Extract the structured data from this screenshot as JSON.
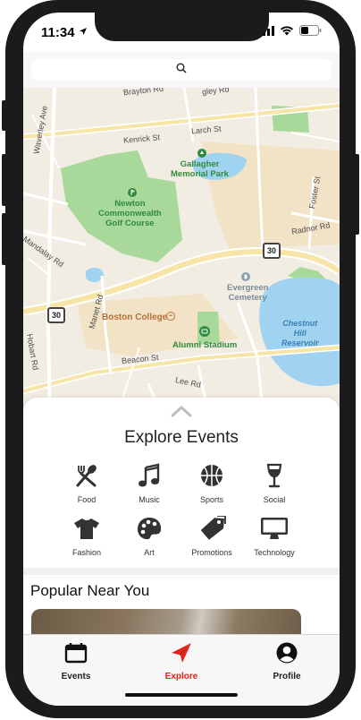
{
  "status_bar": {
    "time": "11:34"
  },
  "search": {
    "icon": "search-icon"
  },
  "map": {
    "streets": [
      "Brayton Rd",
      "Kenrick St",
      "Larch St",
      "Waverley Ave",
      "Mandalay Rd",
      "Manet Rd",
      "Hobart Rd",
      "Beacon St",
      "Lee Rd",
      "Foster St",
      "Radnor Rd",
      "gley Rd"
    ],
    "places": {
      "gallagher": "Gallagher\nMemorial Park",
      "newton": "Newton\nCommonwealth\nGolf Course",
      "boston_college": "Boston College",
      "alumni": "Alumni Stadium",
      "evergreen": "Evergreen\nCemetery",
      "reservoir": "Chestnut\nHill\nReservoir"
    },
    "route_shields": [
      "30",
      "30"
    ]
  },
  "explore": {
    "title": "Explore Events",
    "categories": [
      {
        "label": "Food",
        "icon": "utensils-icon"
      },
      {
        "label": "Music",
        "icon": "music-note-icon"
      },
      {
        "label": "Sports",
        "icon": "basketball-icon"
      },
      {
        "label": "Social",
        "icon": "wine-glass-icon"
      },
      {
        "label": "Fashion",
        "icon": "tshirt-icon"
      },
      {
        "label": "Art",
        "icon": "palette-icon"
      },
      {
        "label": "Promotions",
        "icon": "tags-icon"
      },
      {
        "label": "Technology",
        "icon": "monitor-icon"
      }
    ]
  },
  "popular": {
    "title": "Popular Near You"
  },
  "tabs": [
    {
      "label": "Events",
      "icon": "calendar-icon",
      "active": false
    },
    {
      "label": "Explore",
      "icon": "paper-plane-icon",
      "active": true
    },
    {
      "label": "Profile",
      "icon": "user-circle-icon",
      "active": false
    }
  ],
  "colors": {
    "accent": "#e2231a",
    "park": "#a8d99a",
    "water": "#9fd3f0",
    "map_bg": "#f2ede3"
  }
}
